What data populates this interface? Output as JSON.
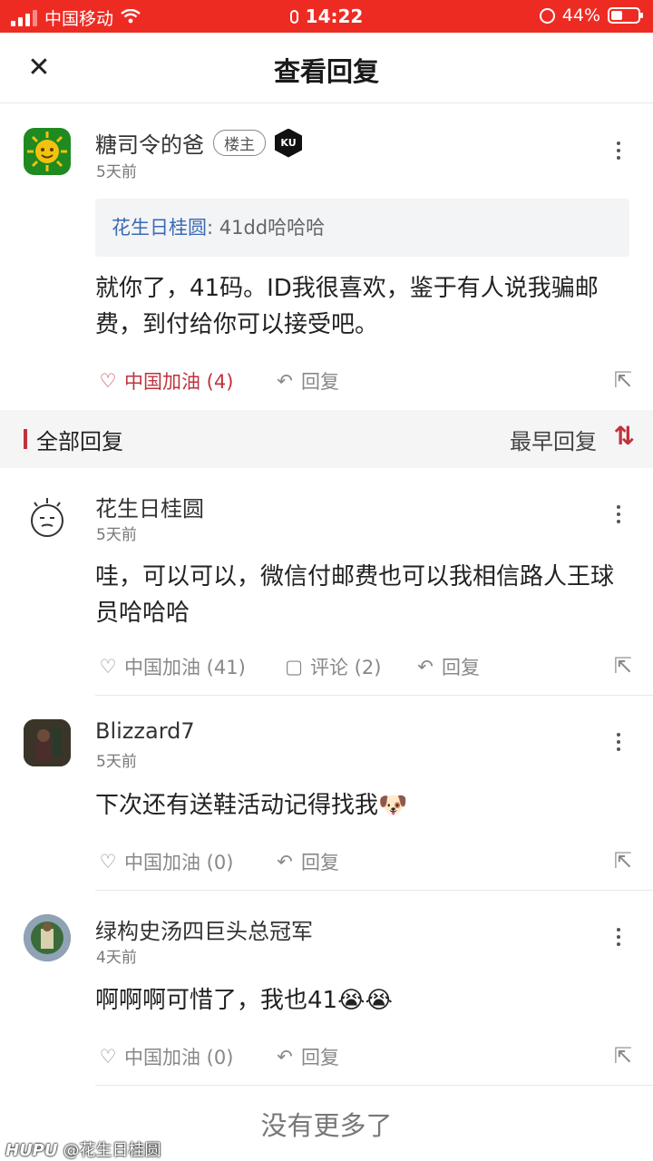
{
  "status_bar": {
    "carrier": "中国移动",
    "time": "14:22",
    "battery": "44%",
    "battery_level": 0.44
  },
  "header": {
    "title": "查看回复"
  },
  "main_post": {
    "author": "糖司令的爸",
    "badge": "楼主",
    "team_logo_text": "KU",
    "time": "5天前",
    "quote_name": "花生日桂圆",
    "quote_text": ": 41dd哈哈哈",
    "content": "就你了，41码。ID我很喜欢，鉴于有人说我骗邮费，到付给你可以接受吧。",
    "like_label": "中国加油 (4)",
    "reply_label": "回复"
  },
  "section": {
    "title": "全部回复",
    "sort_label": "最早回复"
  },
  "replies": [
    {
      "author": "花生日桂圆",
      "time": "5天前",
      "content": "哇，可以可以，微信付邮费也可以我相信路人王球员哈哈哈",
      "like_label": "中国加油 (41)",
      "comment_label": "评论 (2)",
      "reply_label": "回复"
    },
    {
      "author": "Blizzard7",
      "time": "5天前",
      "content": "下次还有送鞋活动记得找我🐶",
      "like_label": "中国加油 (0)",
      "reply_label": "回复"
    },
    {
      "author": "绿构史汤四巨头总冠军",
      "time": "4天前",
      "content": "啊啊啊可惜了，我也41😭😭",
      "like_label": "中国加油 (0)",
      "reply_label": "回复"
    }
  ],
  "footer": {
    "no_more": "没有更多了"
  },
  "watermark": {
    "brand": "HUPU",
    "user": "@花生日桂圆"
  },
  "colors": {
    "status_bar": "#ee2b23",
    "accent_red": "#c0323c",
    "link_blue": "#3a6ab3"
  }
}
